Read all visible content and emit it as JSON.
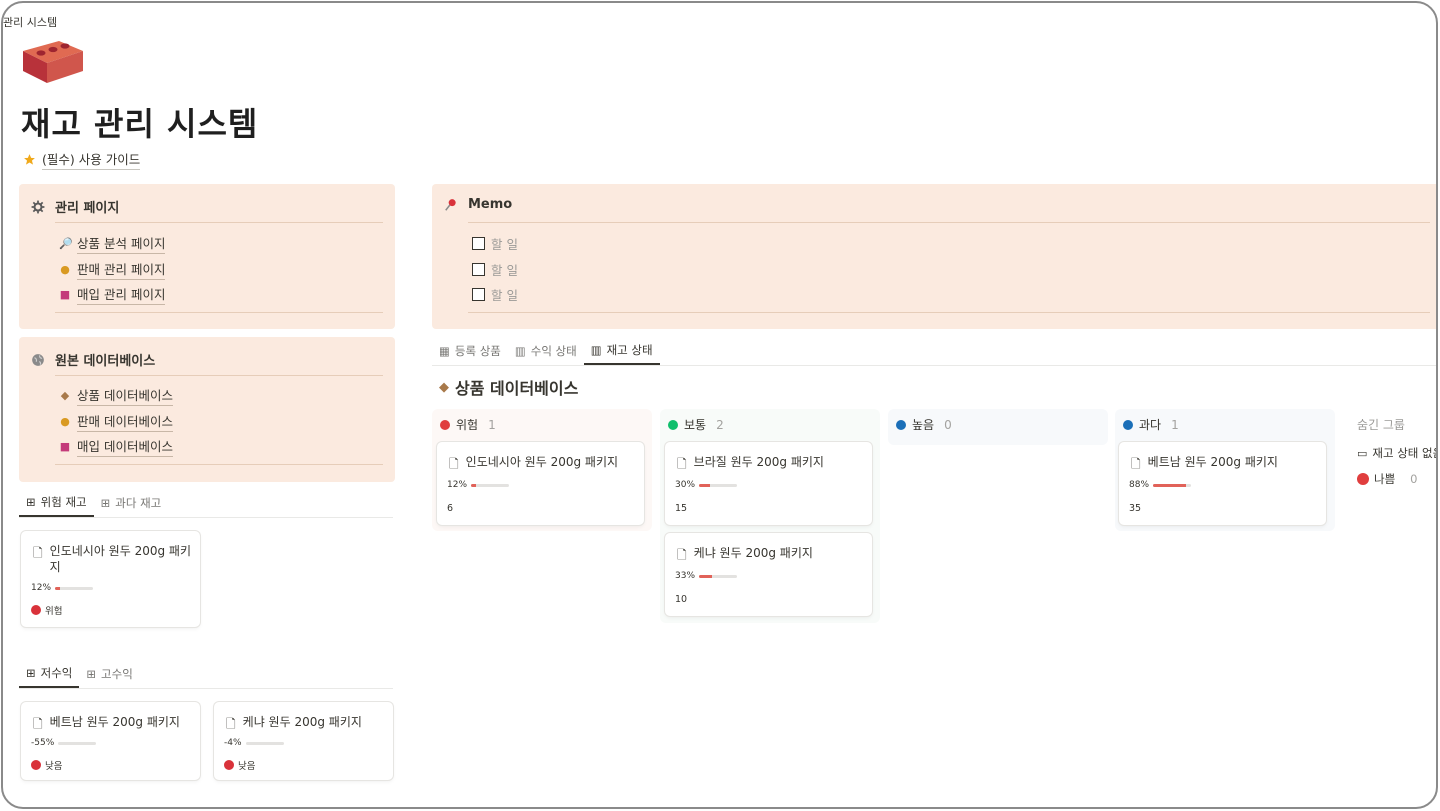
{
  "breadcrumb": "관리 시스템",
  "page": {
    "title": "재고 관리 시스템",
    "guide_link": "(필수) 사용 가이드"
  },
  "admin_callout": {
    "title": "관리 페이지",
    "links": [
      {
        "icon": "magnifier-icon",
        "label": "상품 분석 페이지"
      },
      {
        "icon": "coin-icon",
        "label": "판매 관리 페이지"
      },
      {
        "icon": "shopping-bags-icon",
        "label": "매입 관리 페이지"
      }
    ]
  },
  "source_callout": {
    "title": "원본 데이터베이스",
    "links": [
      {
        "icon": "package-icon",
        "label": "상품 데이터베이스"
      },
      {
        "icon": "coin-icon",
        "label": "판매 데이터베이스"
      },
      {
        "icon": "shopping-bags-icon",
        "label": "매입 데이터베이스"
      }
    ]
  },
  "memo_callout": {
    "title": "Memo",
    "todos": [
      "할 일",
      "할 일",
      "할 일"
    ]
  },
  "risk_view": {
    "tabs": [
      {
        "label": "위험 재고",
        "active": true
      },
      {
        "label": "과다 재고",
        "active": false
      }
    ],
    "cards": [
      {
        "title": "인도네시아 원두 200g 패키지",
        "percent": "12%",
        "fill": 0.12,
        "tag": "위험",
        "tag_color": "#d9323a"
      }
    ]
  },
  "margin_view": {
    "tabs": [
      {
        "label": "저수익",
        "active": true
      },
      {
        "label": "고수익",
        "active": false
      }
    ],
    "cards": [
      {
        "title": "베트남 원두 200g 패키지",
        "percent": "-55%",
        "fill": 0,
        "tag": "낮음",
        "tag_color": "#d9323a"
      },
      {
        "title": "케냐 원두 200g 패키지",
        "percent": "-4%",
        "fill": 0,
        "tag": "낮음",
        "tag_color": "#d9323a"
      }
    ]
  },
  "main_view": {
    "tabs": [
      {
        "label": "등록 상품",
        "active": false
      },
      {
        "label": "수익 상태",
        "active": false
      },
      {
        "label": "재고 상태",
        "active": true
      }
    ],
    "db_title": "상품 데이터베이스",
    "columns": [
      {
        "name": "위험",
        "count": "1",
        "color": "#e03e3e",
        "cards": [
          {
            "title": "인도네시아 원두 200g 패키지",
            "percent": "12%",
            "fill": 0.12,
            "number": "6"
          }
        ]
      },
      {
        "name": "보통",
        "count": "2",
        "color": "#0fbf6c",
        "cards": [
          {
            "title": "브라질 원두 200g 패키지",
            "percent": "30%",
            "fill": 0.3,
            "number": "15"
          },
          {
            "title": "케냐 원두 200g 패키지",
            "percent": "33%",
            "fill": 0.33,
            "number": "10"
          }
        ]
      },
      {
        "name": "높음",
        "count": "0",
        "color": "#1b6fb8",
        "cards": []
      },
      {
        "name": "과다",
        "count": "1",
        "color": "#1b6fb8",
        "cards": [
          {
            "title": "베트남 원두 200g 패키지",
            "percent": "88%",
            "fill": 0.88,
            "number": "35"
          }
        ]
      }
    ],
    "hidden_groups": {
      "label": "숨긴 그룹",
      "items": [
        {
          "icon": "inbox-icon",
          "label": "재고 상태 없음",
          "count": ""
        },
        {
          "icon": "red-dot",
          "label": "나쁨",
          "count": "0"
        }
      ]
    }
  }
}
